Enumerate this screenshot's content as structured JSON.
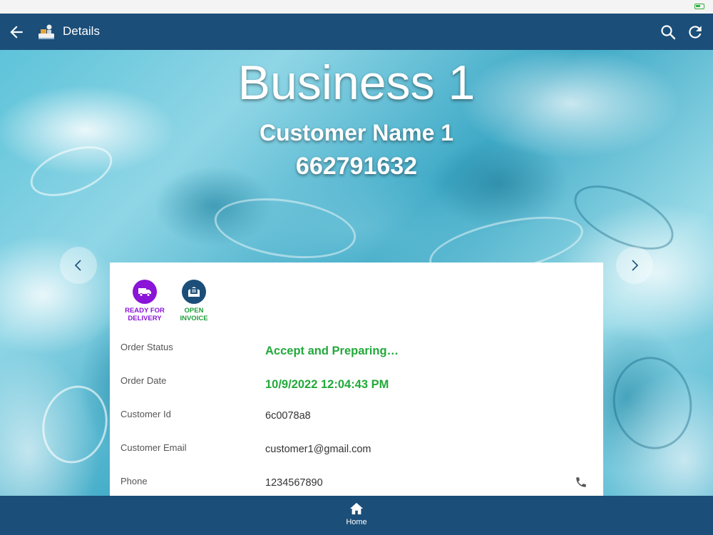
{
  "app_bar": {
    "title": "Details",
    "back_icon": "arrow-left-icon",
    "logo_icon": "business-logo-icon",
    "search_icon": "search-icon",
    "refresh_icon": "refresh-icon"
  },
  "hero": {
    "business_name": "Business 1",
    "customer_name": "Customer Name 1",
    "customer_number": "662791632"
  },
  "actions": [
    {
      "label": "READY FOR DELIVERY",
      "icon": "truck-icon",
      "color": "#8a14d8"
    },
    {
      "label": "OPEN INVOICE",
      "icon": "invoice-icon",
      "color": "#1e9e3a"
    }
  ],
  "details": [
    {
      "key": "Order Status",
      "value": "Accept and Preparing…"
    },
    {
      "key": "Order Date",
      "value": "10/9/2022 12:04:43 PM"
    },
    {
      "key": "Customer Id",
      "value": "6c0078a8"
    },
    {
      "key": "Customer Email",
      "value": "customer1@gmail.com"
    },
    {
      "key": "Phone",
      "value": "1234567890"
    }
  ],
  "bottom_nav": {
    "home_label": "Home",
    "home_icon": "home-icon"
  },
  "colors": {
    "primary": "#1b4e79",
    "accent_green": "#22a93b",
    "accent_purple": "#8a14d8"
  }
}
